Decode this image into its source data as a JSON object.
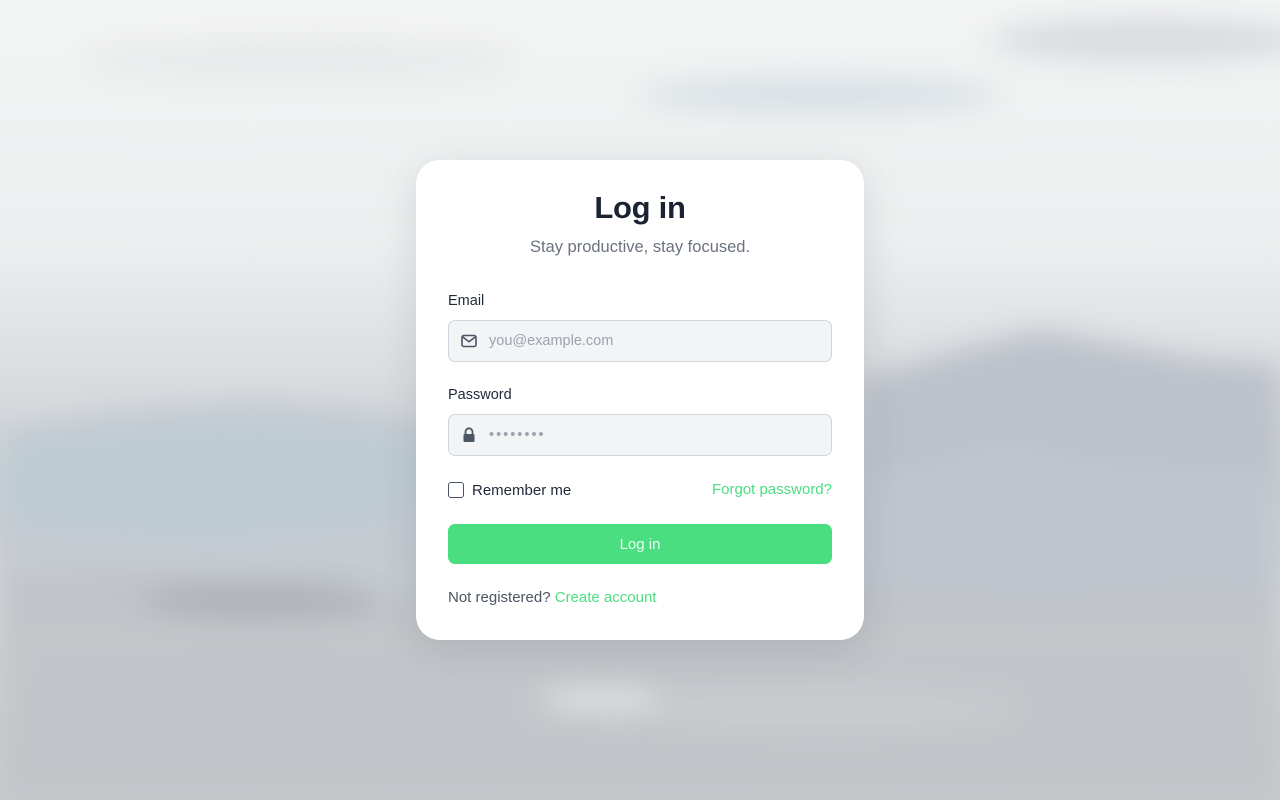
{
  "colors": {
    "accent": "#4ade80",
    "title": "#1b2333",
    "muted": "#6b7280",
    "field_bg": "#f3f4f6"
  },
  "login": {
    "title": "Log in",
    "subtitle": "Stay productive, stay focused.",
    "email": {
      "label": "Email",
      "placeholder": "you@example.com",
      "value": "",
      "icon": "envelope-icon"
    },
    "password": {
      "label": "Password",
      "placeholder": "••••••••",
      "value": "",
      "icon": "lock-icon"
    },
    "remember": {
      "label": "Remember me",
      "checked": false
    },
    "forgot_link": "Forgot password?",
    "submit_label": "Log in",
    "footer": {
      "text": "Not registered?",
      "link": "Create account"
    }
  }
}
